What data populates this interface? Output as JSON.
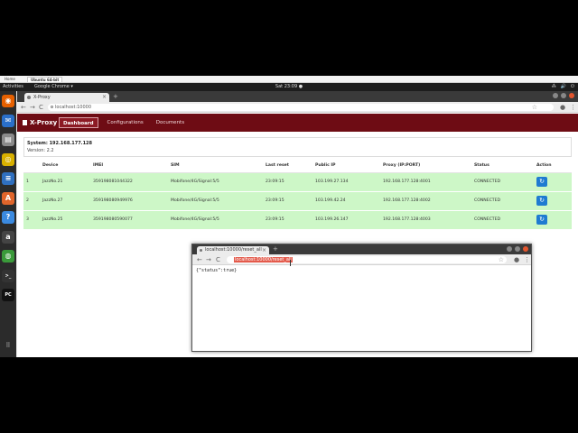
{
  "vm": {
    "tabs": [
      "Home",
      "Ubuntu 64-bit"
    ]
  },
  "gnome": {
    "activities": "Activities",
    "app_menu": "Google Chrome ▾",
    "clock": "Sat 23:09 ●",
    "tray": [
      "⁂",
      "🔊",
      "⏻"
    ]
  },
  "dock": {
    "icons": [
      {
        "name": "firefox-icon",
        "glyph": "◉",
        "color": "#e66000"
      },
      {
        "name": "thunderbird-icon",
        "glyph": "✉",
        "color": "#2a6fc9"
      },
      {
        "name": "files-icon",
        "glyph": "▤",
        "color": "#8a8a8a"
      },
      {
        "name": "rhythmbox-icon",
        "glyph": "◎",
        "color": "#d8b000"
      },
      {
        "name": "writer-icon",
        "glyph": "≡",
        "color": "#2f6fbf"
      },
      {
        "name": "software-icon",
        "glyph": "A",
        "color": "#e0652b"
      },
      {
        "name": "help-icon",
        "glyph": "?",
        "color": "#3b8ae0"
      },
      {
        "name": "amazon-icon",
        "glyph": "a",
        "color": "#444444"
      },
      {
        "name": "chrome-icon",
        "glyph": "◍",
        "color": "#3a9a3a"
      },
      {
        "name": "terminal-icon",
        "glyph": ">_",
        "color": "#333333"
      },
      {
        "name": "pycharm-icon",
        "glyph": "PC",
        "color": "#111111"
      }
    ],
    "apps_glyph": "⠿"
  },
  "chrome_main": {
    "tab_title": "X-Proxy",
    "tab_close": "×",
    "new_tab": "+",
    "url": "localhost:10000",
    "back": "←",
    "forward": "→",
    "reload": "C",
    "star": "☆",
    "menu": "⋮",
    "profile": "●"
  },
  "app": {
    "brand": "X-Proxy",
    "nav": [
      {
        "label": "Dashboard",
        "active": true
      },
      {
        "label": "Configurations",
        "active": false
      },
      {
        "label": "Documents",
        "active": false
      }
    ],
    "system_title": "System: 192.168.177.128",
    "version": "Version: 2.2",
    "columns": [
      "",
      "Device",
      "IMEI",
      "SIM",
      "Last reset",
      "Public IP",
      "Proxy (IP:PORT)",
      "Status",
      "Action"
    ],
    "rows": [
      {
        "n": "1",
        "device": "JazzNo.21",
        "imei": "359198081044322",
        "sim": "Mobifone/4G/Signal:5/5",
        "last_reset": "23:09:15",
        "public_ip": "103.199.27.134",
        "proxy": "192.168.177.128:4001",
        "status": "CONNECTED"
      },
      {
        "n": "2",
        "device": "JazzNo.27",
        "imei": "359198080949976",
        "sim": "Mobifone/4G/Signal:5/5",
        "last_reset": "23:09:15",
        "public_ip": "103.199.42.24",
        "proxy": "192.168.177.128:4002",
        "status": "CONNECTED"
      },
      {
        "n": "3",
        "device": "JazzNo.25",
        "imei": "359198080590077",
        "sim": "Mobifone/4G/Signal:5/5",
        "last_reset": "23:09:15",
        "public_ip": "103.199.26.147",
        "proxy": "192.168.177.128:4003",
        "status": "CONNECTED"
      }
    ],
    "reset_glyph": "↻"
  },
  "popup": {
    "tab_title": "localhost:10000/reset_all",
    "tab_close": "×",
    "new_tab": "+",
    "url": "localhost:10000/reset_all",
    "star": "☆",
    "back": "←",
    "forward": "→",
    "reload": "C",
    "body": "{\"status\":true}"
  }
}
